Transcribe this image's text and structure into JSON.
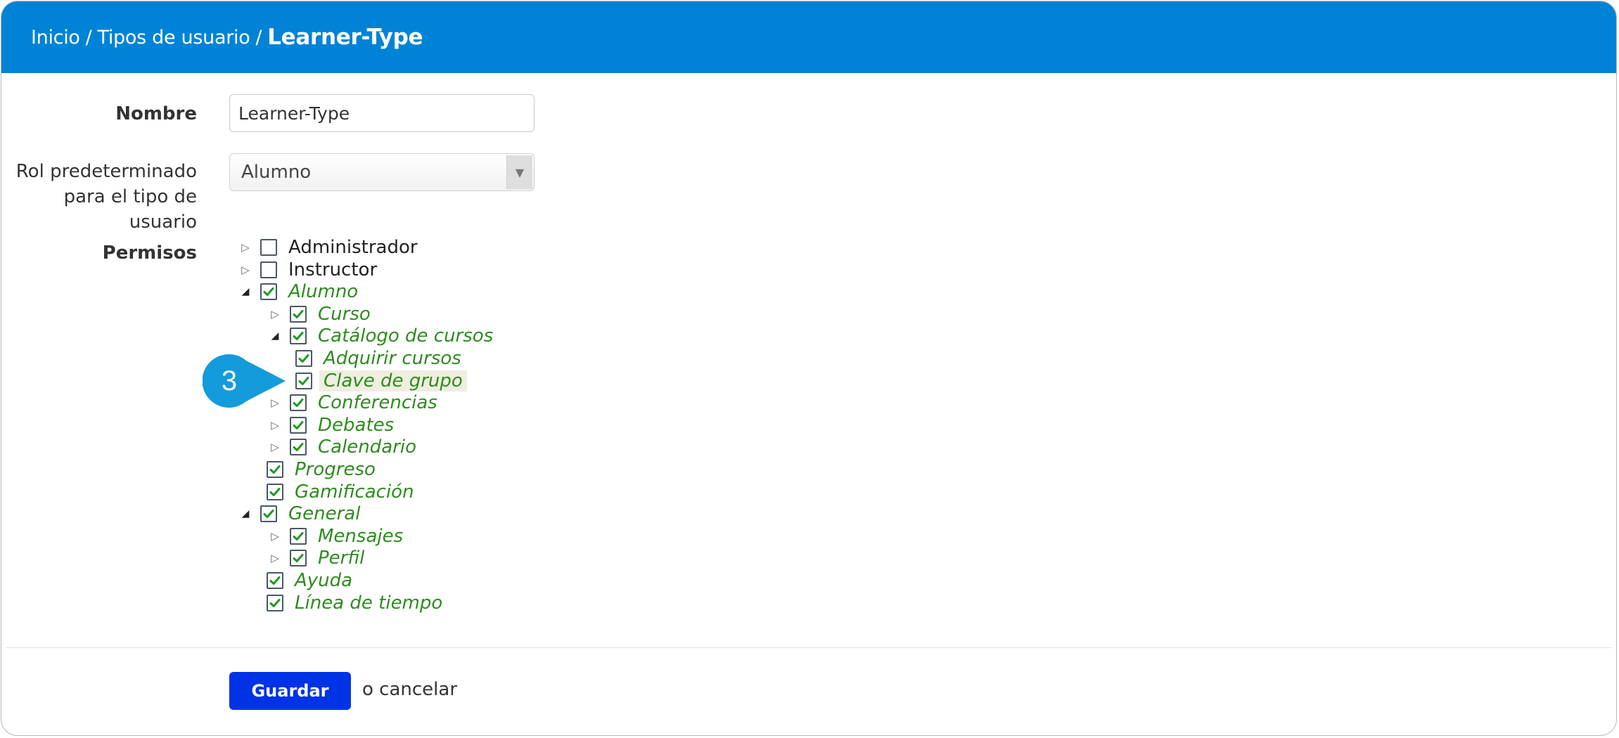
{
  "header": {
    "breadcrumb": [
      "Inicio",
      "Tipos de usuario"
    ],
    "separator": "/",
    "current": "Learner-Type"
  },
  "form": {
    "name_label": "Nombre",
    "name_value": "Learner-Type",
    "role_label_line1": "Rol predeterminado",
    "role_label_line2": "para el tipo de usuario",
    "role_value": "Alumno",
    "permissions_label": "Permisos"
  },
  "permissions": [
    {
      "label": "Administrador",
      "checked": false,
      "toggle": "closed",
      "level": 0
    },
    {
      "label": "Instructor",
      "checked": false,
      "toggle": "closed",
      "level": 0
    },
    {
      "label": "Alumno",
      "checked": true,
      "toggle": "open",
      "level": 0
    },
    {
      "label": "Curso",
      "checked": true,
      "toggle": "closed",
      "level": 1
    },
    {
      "label": "Catálogo de cursos",
      "checked": true,
      "toggle": "open",
      "level": 1
    },
    {
      "label": "Adquirir cursos",
      "checked": true,
      "toggle": "none",
      "level": 2
    },
    {
      "label": "Clave de grupo",
      "checked": true,
      "toggle": "none",
      "level": 2,
      "highlighted": true
    },
    {
      "label": "Conferencias",
      "checked": true,
      "toggle": "closed",
      "level": 1
    },
    {
      "label": "Debates",
      "checked": true,
      "toggle": "closed",
      "level": 1
    },
    {
      "label": "Calendario",
      "checked": true,
      "toggle": "closed",
      "level": 1
    },
    {
      "label": "Progreso",
      "checked": true,
      "toggle": "none",
      "level": 1
    },
    {
      "label": "Gamificación",
      "checked": true,
      "toggle": "none",
      "level": 1
    },
    {
      "label": "General",
      "checked": true,
      "toggle": "open",
      "level": 0
    },
    {
      "label": "Mensajes",
      "checked": true,
      "toggle": "closed",
      "level": 1
    },
    {
      "label": "Perfil",
      "checked": true,
      "toggle": "closed",
      "level": 1
    },
    {
      "label": "Ayuda",
      "checked": true,
      "toggle": "none",
      "level": 1
    },
    {
      "label": "Línea de tiempo",
      "checked": true,
      "toggle": "none",
      "level": 1
    }
  ],
  "actions": {
    "save_label": "Guardar",
    "cancel_label": "o cancelar"
  },
  "callout": {
    "number": "3"
  },
  "colors": {
    "header_bg": "#0083d6",
    "save_bg": "#0033e6",
    "checked_text": "#2e8b1f",
    "check_mark": "#1f9a1f",
    "callout": "#149bdb"
  }
}
